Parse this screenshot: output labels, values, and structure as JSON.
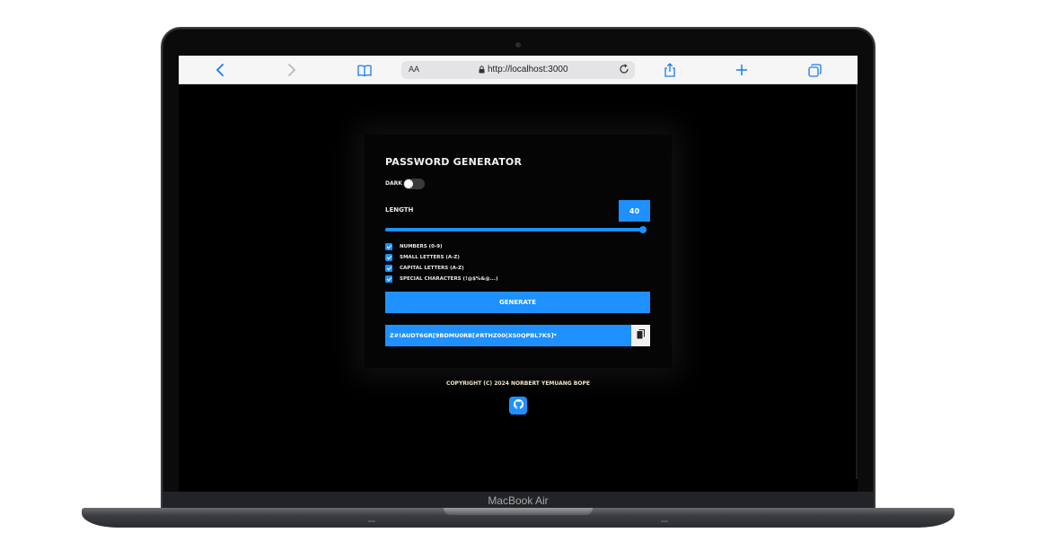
{
  "browser": {
    "url": "http://localhost:3000",
    "reader_label": "AA"
  },
  "app": {
    "title": "PASSWORD GENERATOR",
    "dark_label": "DARK",
    "dark_enabled": false,
    "length_label": "LENGTH",
    "length_value": "40",
    "length_slider_fraction": 1.0,
    "options": [
      {
        "label": "NUMBERS (0-9)",
        "checked": true
      },
      {
        "label": "SMALL LETTERS (A-Z)",
        "checked": true
      },
      {
        "label": "CAPITAL LETTERS (A-Z)",
        "checked": true
      },
      {
        "label": "SPECIAL CHARACTERS (!@$%&@...)",
        "checked": true
      }
    ],
    "generate_label": "GENERATE",
    "password": "Z#!AUDT6GR[9BDMU0RB[#RTHZ00(XS0QPBL7KS]*",
    "accent_color": "#1e90ff"
  },
  "footer": {
    "copyright": "COPYRIGHT (C) 2024 NORBERT YEMUANG BOPE"
  },
  "device": {
    "model": "MacBook Air"
  }
}
